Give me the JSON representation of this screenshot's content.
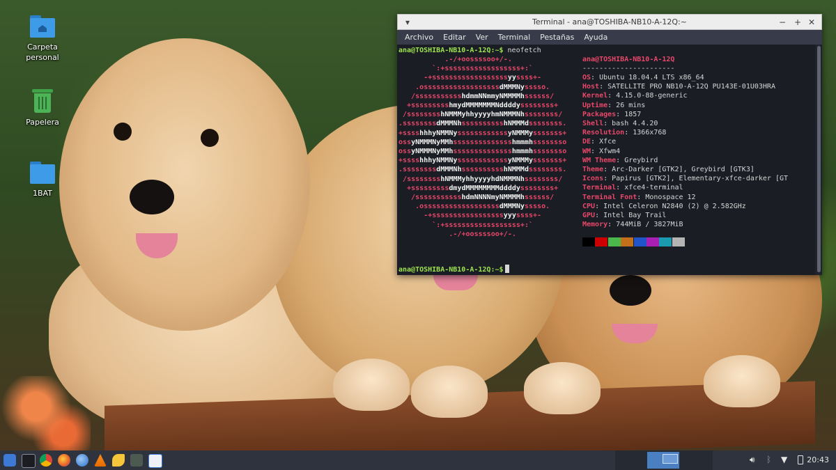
{
  "desktop": {
    "icons": [
      {
        "label": "Carpeta\npersonal",
        "icon": "home-folder-icon"
      },
      {
        "label": "Papelera",
        "icon": "trash-icon"
      },
      {
        "label": "1BAT",
        "icon": "folder-icon"
      }
    ]
  },
  "terminal": {
    "title": "Terminal - ana@TOSHIBA-NB10-A-12Q:~",
    "menu": [
      "Archivo",
      "Editar",
      "Ver",
      "Terminal",
      "Pestañas",
      "Ayuda"
    ],
    "prompt": "ana@TOSHIBA-NB10-A-12Q:~$",
    "command": " neofetch",
    "header": "ana@TOSHIBA-NB10-A-12Q",
    "separator": "----------------------",
    "art": [
      "           .-/+oossssoo+/-.",
      "        `:+ssssssssssssssssss+:`",
      "      -+ssssssssssssssssssyyssss+-",
      "    .ossssssssssssssssssdMMMNysssso.",
      "   /ssssssssssshdmmNNmmyNMMMMhssssss/",
      "  +ssssssssshmydMMMMMMMNddddyssssssss+",
      " /sssssssshNMMMyhhyyyyhmNMMMNhssssssss/",
      ".ssssssssdMMMNhsssssssssshNMMMdssssssss.",
      "+sssshhhyNMMNyssssssssssssyNMMMysssssss+",
      "ossyNMMMNyMMhsssssssssssssshmmmhssssssso",
      "ossyNMMMNyMMhsssssssssssssshmmmhssssssso",
      "+sssshhhyNMMNyssssssssssssyNMMMysssssss+",
      ".ssssssssdMMMNhsssssssssshNMMMdssssssss.",
      " /sssssssshNMMMyhhyyyyhdNMMMNhssssssss/",
      "  +sssssssssdmydMMMMMMMMddddyssssssss+",
      "   /ssssssssssshdmNNNNmyNMMMMhssssss/",
      "    .ossssssssssssssssssdMMMNysssso.",
      "      -+sssssssssssssssssyyyssss+-",
      "        `:+ssssssssssssssssss+:`",
      "            .-/+oossssoo+/-."
    ],
    "info": [
      {
        "key": "OS",
        "value": "Ubuntu 18.04.4 LTS x86_64"
      },
      {
        "key": "Host",
        "value": "SATELLITE PRO NB10-A-12Q PU143E-01U03HRA"
      },
      {
        "key": "Kernel",
        "value": "4.15.0-88-generic"
      },
      {
        "key": "Uptime",
        "value": "26 mins"
      },
      {
        "key": "Packages",
        "value": "1857"
      },
      {
        "key": "Shell",
        "value": "bash 4.4.20"
      },
      {
        "key": "Resolution",
        "value": "1366x768"
      },
      {
        "key": "DE",
        "value": "Xfce"
      },
      {
        "key": "WM",
        "value": "Xfwm4"
      },
      {
        "key": "WM Theme",
        "value": "Greybird"
      },
      {
        "key": "Theme",
        "value": "Arc-Darker [GTK2], Greybird [GTK3]"
      },
      {
        "key": "Icons",
        "value": "Papirus [GTK2], Elementary-xfce-darker [GT"
      },
      {
        "key": "Terminal",
        "value": "xfce4-terminal"
      },
      {
        "key": "Terminal Font",
        "value": "Monospace 12"
      },
      {
        "key": "CPU",
        "value": "Intel Celeron N2840 (2) @ 2.582GHz"
      },
      {
        "key": "GPU",
        "value": "Intel Bay Trail"
      },
      {
        "key": "Memory",
        "value": "744MiB / 3827MiB"
      }
    ],
    "palette": [
      "#000000",
      "#cc0000",
      "#4cb84c",
      "#c4701a",
      "#1f55c9",
      "#a81fb4",
      "#1a9bb0",
      "#b4b4b4"
    ]
  },
  "taskbar": {
    "clock": "20:43",
    "launchers": [
      "whisker-menu-icon",
      "terminal-icon",
      "chrome-icon",
      "firefox-icon",
      "thunderbird-icon",
      "vlc-icon",
      "banana-icon",
      "calculator-icon",
      "text-editor-icon"
    ]
  }
}
